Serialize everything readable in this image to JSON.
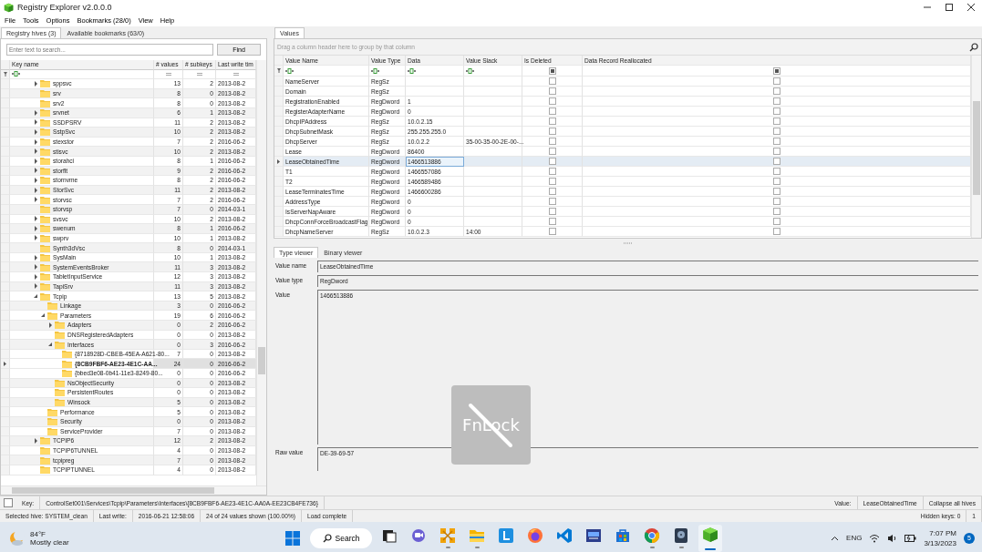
{
  "window": {
    "title": "Registry Explorer v2.0.0.0"
  },
  "menu": [
    "File",
    "Tools",
    "Options",
    "Bookmarks (28/0)",
    "View",
    "Help"
  ],
  "left_tabs": [
    {
      "label": "Registry hives (3)",
      "selected": true
    },
    {
      "label": "Available bookmarks (63/0)",
      "selected": false
    }
  ],
  "search": {
    "placeholder": "Enter text to search...",
    "button": "Find"
  },
  "tree_columns": [
    "Key name",
    "# values",
    "# subkeys",
    "Last write tim"
  ],
  "keys": [
    {
      "name": "sppsvc",
      "values": "13",
      "subkeys": "2",
      "written": "2013-08-2",
      "expandable": true,
      "expanded": false,
      "selected": false
    },
    {
      "name": "srv",
      "values": "8",
      "subkeys": "0",
      "written": "2013-08-2",
      "expandable": false,
      "selected": false
    },
    {
      "name": "srv2",
      "values": "8",
      "subkeys": "0",
      "written": "2013-08-2",
      "expandable": false,
      "selected": false
    },
    {
      "name": "srvnet",
      "values": "6",
      "subkeys": "1",
      "written": "2013-08-2",
      "expandable": true,
      "expanded": false,
      "selected": false
    },
    {
      "name": "SSDPSRV",
      "values": "11",
      "subkeys": "2",
      "written": "2013-08-2",
      "expandable": true,
      "expanded": false,
      "selected": false
    },
    {
      "name": "SstpSvc",
      "values": "10",
      "subkeys": "2",
      "written": "2013-08-2",
      "expandable": true,
      "expanded": false,
      "selected": false
    },
    {
      "name": "stexstor",
      "values": "7",
      "subkeys": "2",
      "written": "2016-06-2",
      "expandable": true,
      "expanded": false,
      "selected": false
    },
    {
      "name": "stisvc",
      "values": "10",
      "subkeys": "2",
      "written": "2013-08-2",
      "expandable": true,
      "expanded": false,
      "selected": false
    },
    {
      "name": "storahci",
      "values": "8",
      "subkeys": "1",
      "written": "2016-06-2",
      "expandable": true,
      "expanded": false,
      "selected": false
    },
    {
      "name": "storflt",
      "values": "9",
      "subkeys": "2",
      "written": "2016-06-2",
      "expandable": true,
      "expanded": false,
      "selected": false
    },
    {
      "name": "stornvme",
      "values": "8",
      "subkeys": "2",
      "written": "2016-06-2",
      "expandable": true,
      "expanded": false,
      "selected": false
    },
    {
      "name": "StorSvc",
      "values": "11",
      "subkeys": "2",
      "written": "2013-08-2",
      "expandable": true,
      "expanded": false,
      "selected": false
    },
    {
      "name": "storvsc",
      "values": "7",
      "subkeys": "2",
      "written": "2016-06-2",
      "expandable": true,
      "expanded": false,
      "selected": false
    },
    {
      "name": "storvsp",
      "values": "7",
      "subkeys": "0",
      "written": "2014-03-1",
      "expandable": false,
      "selected": false
    },
    {
      "name": "svsvc",
      "values": "10",
      "subkeys": "2",
      "written": "2013-08-2",
      "expandable": true,
      "expanded": false,
      "selected": false
    },
    {
      "name": "swenum",
      "values": "8",
      "subkeys": "1",
      "written": "2016-06-2",
      "expandable": true,
      "expanded": false,
      "selected": false
    },
    {
      "name": "swprv",
      "values": "10",
      "subkeys": "1",
      "written": "2013-08-2",
      "expandable": true,
      "expanded": false,
      "selected": false
    },
    {
      "name": "Synth3dVsc",
      "values": "8",
      "subkeys": "0",
      "written": "2014-03-1",
      "expandable": false,
      "selected": false
    },
    {
      "name": "SysMain",
      "values": "10",
      "subkeys": "1",
      "written": "2013-08-2",
      "expandable": true,
      "expanded": false,
      "selected": false
    },
    {
      "name": "SystemEventsBroker",
      "values": "11",
      "subkeys": "3",
      "written": "2013-08-2",
      "expandable": true,
      "expanded": false,
      "selected": false
    },
    {
      "name": "TabletInputService",
      "values": "12",
      "subkeys": "3",
      "written": "2013-08-2",
      "expandable": true,
      "expanded": false,
      "selected": false
    },
    {
      "name": "TapiSrv",
      "values": "11",
      "subkeys": "3",
      "written": "2013-08-2",
      "expandable": true,
      "expanded": false,
      "selected": false
    },
    {
      "name": "Tcpip",
      "values": "13",
      "subkeys": "5",
      "written": "2013-08-2",
      "expandable": true,
      "expanded": true,
      "selected": false,
      "children": [
        {
          "name": "Linkage",
          "values": "3",
          "subkeys": "0",
          "written": "2016-06-2",
          "expandable": false,
          "selected": false
        },
        {
          "name": "Parameters",
          "values": "19",
          "subkeys": "6",
          "written": "2016-06-2",
          "expandable": true,
          "expanded": true,
          "selected": false,
          "children": [
            {
              "name": "Adapters",
              "values": "0",
              "subkeys": "2",
              "written": "2016-06-2",
              "expandable": true,
              "expanded": false,
              "selected": false
            },
            {
              "name": "DNSRegisteredAdapters",
              "values": "0",
              "subkeys": "0",
              "written": "2013-08-2",
              "expandable": false,
              "selected": false
            },
            {
              "name": "Interfaces",
              "values": "0",
              "subkeys": "3",
              "written": "2016-06-2",
              "expandable": true,
              "expanded": true,
              "selected": false,
              "children": [
                {
                  "name": "{8718928D-CBEB-45EA-A621-80...",
                  "values": "7",
                  "subkeys": "0",
                  "written": "2013-08-2",
                  "expandable": false,
                  "selected": false
                },
                {
                  "name": "{8CB9FBF6-AE23-4E1C-AA...",
                  "values": "24",
                  "subkeys": "0",
                  "written": "2016-06-2",
                  "expandable": false,
                  "selected": true
                },
                {
                  "name": "{bbed3e08-0b41-11e3-8249-80...",
                  "values": "0",
                  "subkeys": "0",
                  "written": "2016-06-2",
                  "expandable": false,
                  "selected": false
                }
              ]
            },
            {
              "name": "NsObjectSecurity",
              "values": "0",
              "subkeys": "0",
              "written": "2013-08-2",
              "expandable": false,
              "selected": false
            },
            {
              "name": "PersistentRoutes",
              "values": "0",
              "subkeys": "0",
              "written": "2013-08-2",
              "expandable": false,
              "selected": false
            },
            {
              "name": "Winsock",
              "values": "5",
              "subkeys": "0",
              "written": "2013-08-2",
              "expandable": false,
              "selected": false
            }
          ]
        },
        {
          "name": "Performance",
          "values": "5",
          "subkeys": "0",
          "written": "2013-08-2",
          "expandable": false,
          "selected": false
        },
        {
          "name": "Security",
          "values": "0",
          "subkeys": "0",
          "written": "2013-08-2",
          "expandable": false,
          "selected": false
        },
        {
          "name": "ServiceProvider",
          "values": "7",
          "subkeys": "0",
          "written": "2013-08-2",
          "expandable": false,
          "selected": false
        }
      ]
    },
    {
      "name": "TCPIP6",
      "values": "12",
      "subkeys": "2",
      "written": "2013-08-2",
      "expandable": true,
      "expanded": false,
      "selected": false
    },
    {
      "name": "TCPIP6TUNNEL",
      "values": "4",
      "subkeys": "0",
      "written": "2013-08-2",
      "expandable": false,
      "selected": false
    },
    {
      "name": "tcpipreg",
      "values": "7",
      "subkeys": "0",
      "written": "2013-08-2",
      "expandable": false,
      "selected": false
    },
    {
      "name": "TCPIPTUNNEL",
      "values": "4",
      "subkeys": "0",
      "written": "2013-08-2",
      "expandable": false,
      "selected": false
    }
  ],
  "values_tab": "Values",
  "group_hint": "Drag a column header here to group by that column",
  "value_columns": [
    "Value Name",
    "Value Type",
    "Data",
    "Value Slack",
    "Is Deleted",
    "Data Record Reallocated"
  ],
  "values": [
    {
      "name": "NameServer",
      "type": "RegSz",
      "is_deleted": false,
      "reallocated": false,
      "selected": false
    },
    {
      "name": "Domain",
      "type": "RegSz",
      "is_deleted": false,
      "reallocated": false,
      "selected": false
    },
    {
      "name": "RegistrationEnabled",
      "type": "RegDword",
      "data": "1",
      "is_deleted": false,
      "reallocated": false,
      "selected": false
    },
    {
      "name": "RegisterAdapterName",
      "type": "RegDword",
      "data": "0",
      "is_deleted": false,
      "reallocated": false,
      "selected": false
    },
    {
      "name": "DhcpIPAddress",
      "type": "RegSz",
      "data": "10.0.2.15",
      "is_deleted": false,
      "reallocated": false,
      "selected": false
    },
    {
      "name": "DhcpSubnetMask",
      "type": "RegSz",
      "data": "255.255.255.0",
      "is_deleted": false,
      "reallocated": false,
      "selected": false
    },
    {
      "name": "DhcpServer",
      "type": "RegSz",
      "data": "10.0.2.2",
      "slack": "35-00-35-00-2E-00-...",
      "is_deleted": false,
      "reallocated": false,
      "selected": false
    },
    {
      "name": "Lease",
      "type": "RegDword",
      "data": "86400",
      "is_deleted": false,
      "reallocated": false,
      "selected": false
    },
    {
      "name": "LeaseObtainedTime",
      "type": "RegDword",
      "data": "1466513886",
      "is_deleted": false,
      "reallocated": false,
      "selected": true
    },
    {
      "name": "T1",
      "type": "RegDword",
      "data": "1466557086",
      "is_deleted": false,
      "reallocated": false,
      "selected": false
    },
    {
      "name": "T2",
      "type": "RegDword",
      "data": "1466589486",
      "is_deleted": false,
      "reallocated": false,
      "selected": false
    },
    {
      "name": "LeaseTerminatesTime",
      "type": "RegDword",
      "data": "1466600286",
      "is_deleted": false,
      "reallocated": false,
      "selected": false
    },
    {
      "name": "AddressType",
      "type": "RegDword",
      "data": "0",
      "is_deleted": false,
      "reallocated": false,
      "selected": false
    },
    {
      "name": "IsServerNapAware",
      "type": "RegDword",
      "data": "0",
      "is_deleted": false,
      "reallocated": false,
      "selected": false
    },
    {
      "name": "DhcpConnForceBroadcastFlag",
      "type": "RegDword",
      "data": "0",
      "is_deleted": false,
      "reallocated": false,
      "selected": false
    },
    {
      "name": "DhcpNameServer",
      "type": "RegSz",
      "data": "10.0.2.3",
      "slack": "14:00",
      "is_deleted": false,
      "reallocated": false,
      "selected": false
    }
  ],
  "viewer_tabs": [
    {
      "label": "Type viewer",
      "selected": true
    },
    {
      "label": "Binary viewer",
      "selected": false
    }
  ],
  "viewer": {
    "value_name_label": "Value name",
    "value_name": "LeaseObtainedTime",
    "value_type_label": "Value type",
    "value_type": "RegDword",
    "value_label": "Value",
    "value": "1466513886",
    "raw_label": "Raw value",
    "raw": "DE-39-69-57"
  },
  "osd": {
    "text": "FnLock"
  },
  "status": {
    "checked": false,
    "key_label": "Key:",
    "key_path": "ControlSet001\\Services\\Tcpip\\Parameters\\Interfaces\\{8CB9FBF6-AE23-4E1C-AA0A-EE23CB4FE736}",
    "value_label": "Value:",
    "value": "LeaseObtainedTime",
    "collapse": "Collapse all hives",
    "hive": "Selected hive: SYSTEM_clean",
    "last_write_label": "Last write:",
    "last_write": "2016-06-21 12:58:06",
    "shown": "24 of 24 values shown (100.00%)",
    "load": "Load complete",
    "hidden": "Hidden keys: 0",
    "count": "1"
  },
  "taskbar": {
    "temperature": "84°F",
    "weather": "Mostly clear",
    "search": "Search",
    "apps": [
      {
        "kind": "taskview",
        "running": false,
        "active": false
      },
      {
        "kind": "chat",
        "running": false,
        "active": false
      },
      {
        "kind": "network",
        "running": true,
        "active": false
      },
      {
        "kind": "explorer",
        "running": true,
        "active": false
      },
      {
        "kind": "letter",
        "running": false,
        "active": false
      },
      {
        "kind": "firefox",
        "running": false,
        "active": false
      },
      {
        "kind": "vscode",
        "running": false,
        "active": false
      },
      {
        "kind": "dev",
        "running": false,
        "active": false
      },
      {
        "kind": "store",
        "running": false,
        "active": false
      },
      {
        "kind": "chrome",
        "running": true,
        "active": false
      },
      {
        "kind": "disk",
        "running": true,
        "active": false
      },
      {
        "kind": "registry",
        "running": true,
        "active": true
      }
    ],
    "language": "ENG",
    "time": "7:07 PM",
    "date": "3/13/2023",
    "notifications": "5"
  }
}
